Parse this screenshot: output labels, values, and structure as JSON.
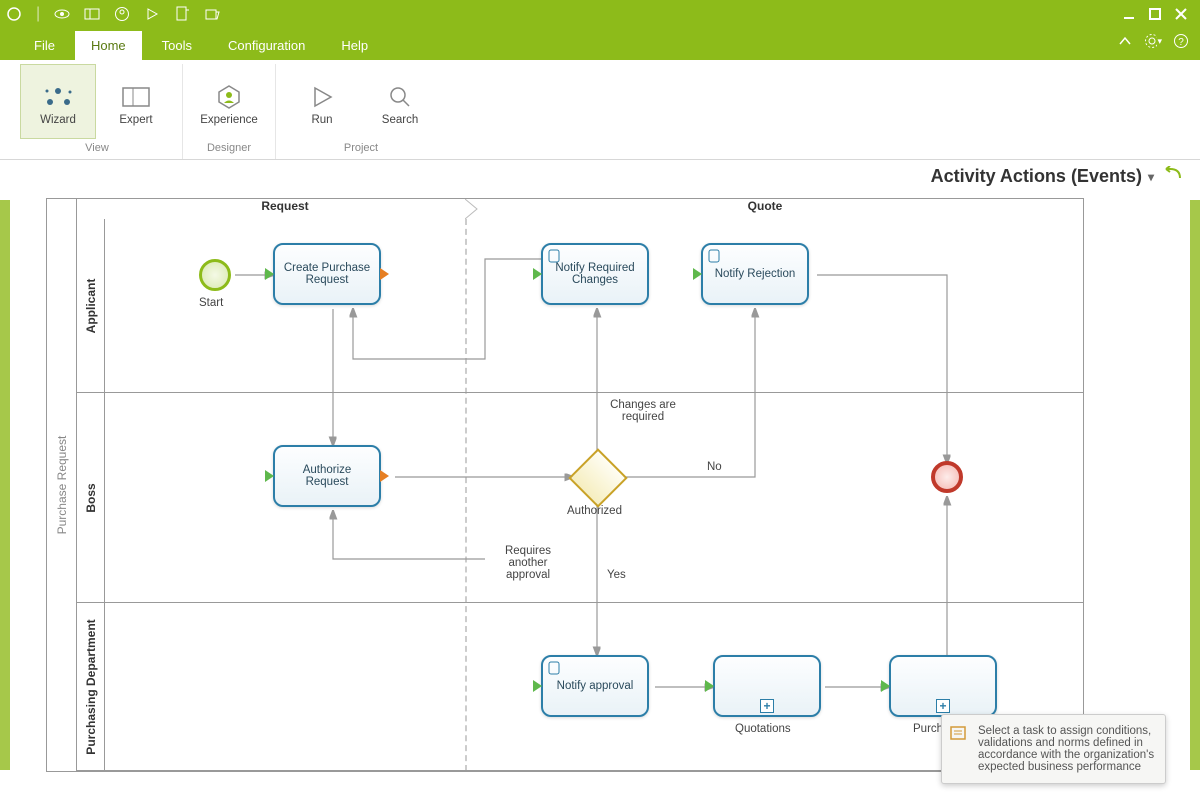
{
  "menu": {
    "file": "File",
    "home": "Home",
    "tools": "Tools",
    "configuration": "Configuration",
    "help": "Help"
  },
  "ribbon": {
    "groupView": "View",
    "groupDesigner": "Designer",
    "groupProject": "Project",
    "wizard": "Wizard",
    "expert": "Expert",
    "experience": "Experience",
    "run": "Run",
    "search": "Search"
  },
  "panelTitle": "Activity Actions (Events)",
  "pool": {
    "name": "Purchase Request"
  },
  "lanes": {
    "applicant": "Applicant",
    "boss": "Boss",
    "purchasing": "Purchasing Department"
  },
  "phases": {
    "request": "Request",
    "quote": "Quote"
  },
  "tasks": {
    "createPurchaseRequest": "Create Purchase Request",
    "notifyRequiredChanges": "Notify Required Changes",
    "notifyRejection": "Notify Rejection",
    "authorizeRequest": "Authorize Request",
    "notifyApproval": "Notify approval",
    "quotations": "Quotations",
    "purchase": "Purchase"
  },
  "events": {
    "start": "Start"
  },
  "gatewayLabels": {
    "authorized": "Authorized",
    "changesRequired": "Changes are required",
    "no": "No",
    "yes": "Yes",
    "requiresAnother": "Requires another approval"
  },
  "tooltip": "Select a task to assign conditions, validations and norms defined in accordance with the organization's expected business performance",
  "colors": {
    "brand": "#8dbb1a",
    "taskBorder": "#2c7ea8",
    "end": "#c0392b"
  }
}
